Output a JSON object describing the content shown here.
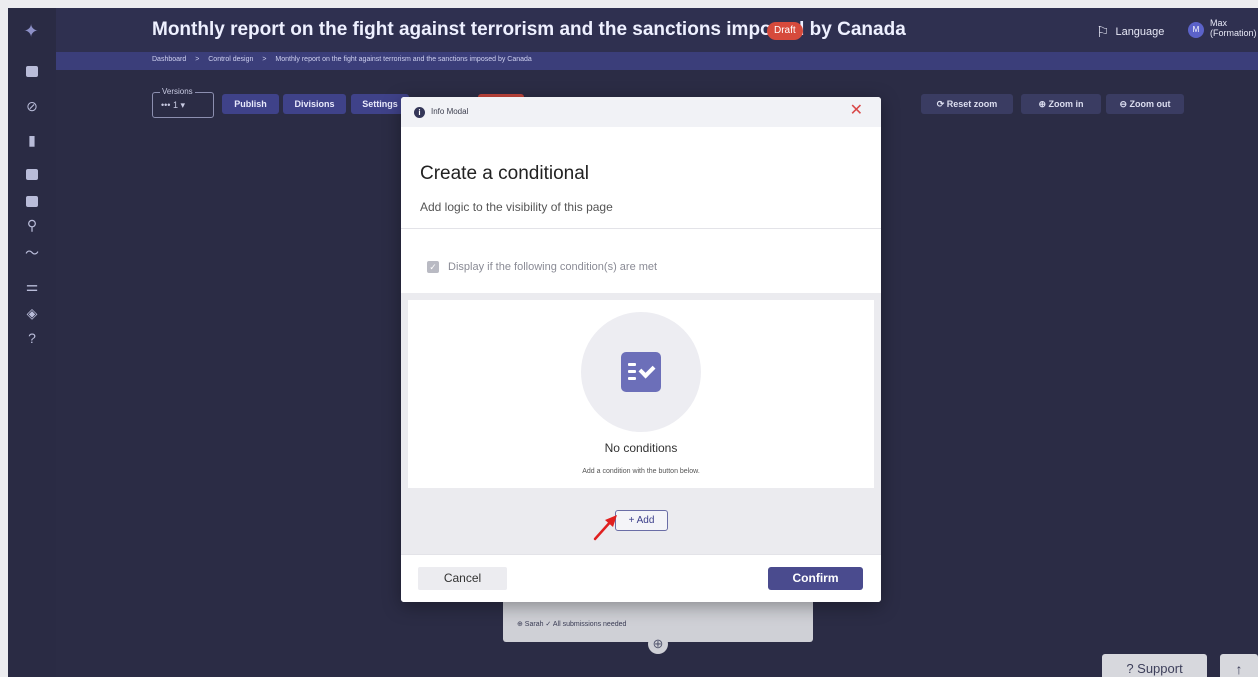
{
  "header": {
    "title": "Monthly report on the fight against terrorism and the sanctions imposed by Canada",
    "status_badge": "Draft",
    "language_label": "Language",
    "user_initial": "M",
    "user_name": "Max",
    "user_role": "(Formation)"
  },
  "breadcrumb": {
    "items": [
      "Dashboard",
      "Control design",
      "Monthly report on the fight against terrorism and the sanctions imposed by Canada"
    ],
    "separator": ">"
  },
  "sidebar": {
    "icons": [
      "logo-icon",
      "report-icon",
      "check-circle-icon",
      "chat-icon",
      "chart-icon",
      "gallery-icon",
      "search-icon",
      "trend-icon",
      "sliders-icon",
      "shield-icon",
      "help-icon"
    ]
  },
  "toolbar": {
    "versions_label": "Versions",
    "versions_value": "••• 1 ▾",
    "publish": "Publish",
    "divisions": "Divisions",
    "settings": "Settings",
    "reset_zoom": "Reset zoom",
    "zoom_in": "Zoom in",
    "zoom_out": "Zoom out"
  },
  "canvas": {
    "node_text": "⊕ Sarah  ✓ All submissions needed",
    "add_node": "⊕"
  },
  "modal": {
    "header_title": "Info Modal",
    "close": "✕",
    "title": "Create a conditional",
    "subtitle": "Add logic to the visibility of this page",
    "checkbox_label": "Display if the following condition(s) are met",
    "checkbox_checked": true,
    "empty_title": "No conditions",
    "empty_hint": "Add a condition with the button below.",
    "add_button": "+ Add",
    "cancel": "Cancel",
    "confirm": "Confirm"
  },
  "footer": {
    "support": "?  Support",
    "scroll_top": "↑"
  },
  "colors": {
    "background": "#2b2c45",
    "accent": "#4a4b8e",
    "draft_badge": "#d64a3c",
    "close": "#d94848",
    "annotation_arrow": "#e02020"
  }
}
